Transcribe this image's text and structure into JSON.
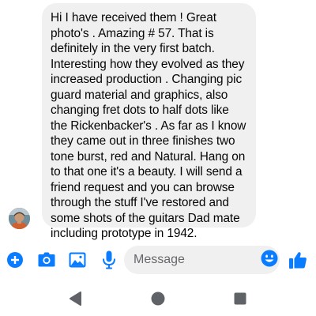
{
  "message": {
    "lines": [
      "Hi I have received them ! Great",
      "photo's . Amazing # 57. That is",
      "definitely in the very first batch.",
      "Interesting how they evolved as they",
      "increased production . Changing pic",
      "guard material and graphics, also",
      "changing fret dots to half dots like",
      "the Rickenbacker's . As far as I know",
      "they came out in three finishes two",
      "tone burst, red and Natural. Hang on",
      "to that one it's a beauty. I will send a",
      "friend request and you can browse",
      "through the stuff I've restored and",
      "some shots of the guitars Dad mate",
      "including prototype in 1942."
    ]
  },
  "composer": {
    "placeholder": "Message",
    "value": "",
    "icons": {
      "add": "plus-circle-icon",
      "camera": "camera-icon",
      "gallery": "image-icon",
      "voice": "microphone-icon",
      "emoji": "emoji-icon",
      "like": "thumbs-up-icon"
    }
  },
  "navbar": {
    "icons": [
      "back-triangle-icon",
      "home-circle-icon",
      "recents-square-icon"
    ]
  },
  "colors": {
    "accent": "#0a7cff",
    "bubble": "#f0f0f0",
    "text": "#050505",
    "nav": "#5f6368"
  }
}
